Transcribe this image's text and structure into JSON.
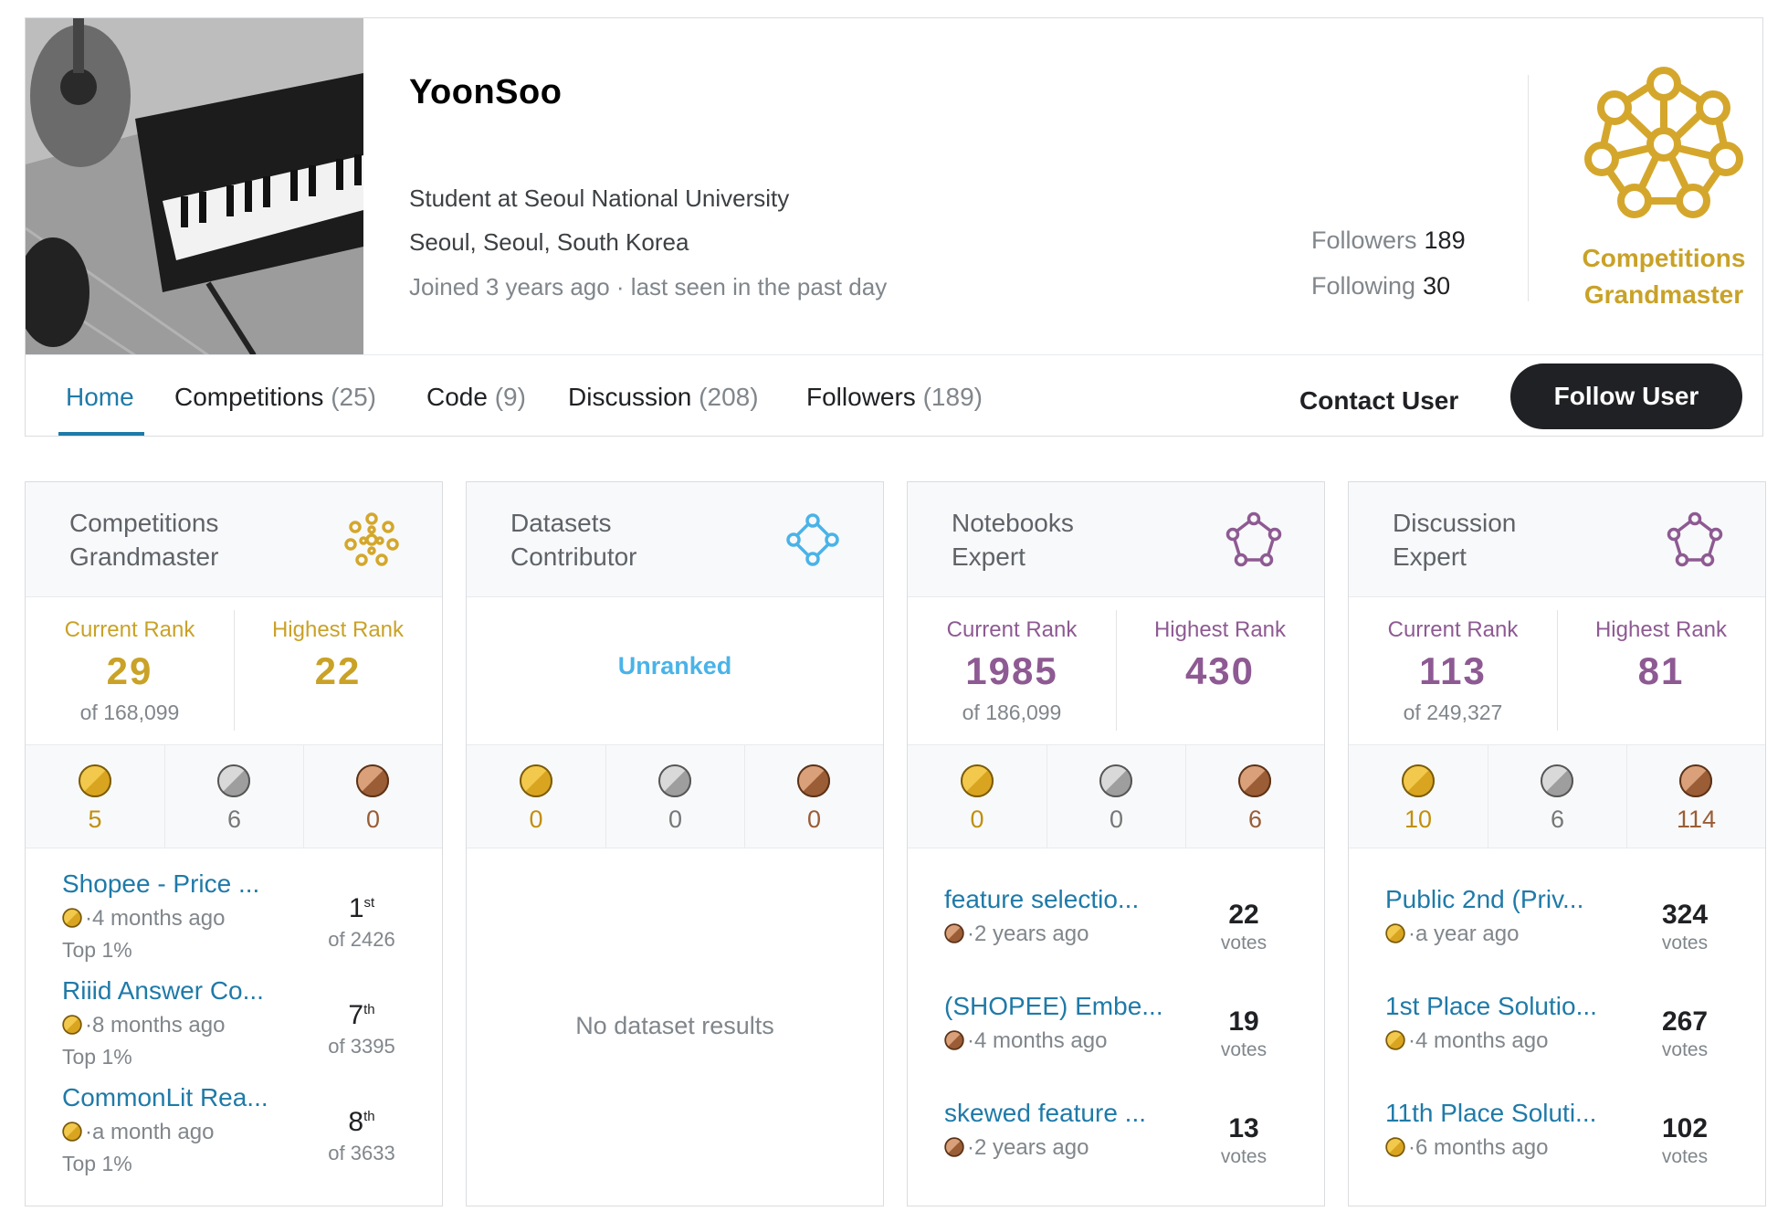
{
  "profile": {
    "name": "YoonSoo",
    "occupation": "Student at Seoul National University",
    "location": "Seoul, Seoul, South Korea",
    "meta": "Joined 3 years ago · last seen in the past day",
    "followers_label": "Followers",
    "followers_count": "189",
    "following_label": "Following",
    "following_count": "30",
    "tier_line1": "Competitions",
    "tier_line2": "Grandmaster",
    "tier_color": "#c9a227"
  },
  "tabs": [
    {
      "label": "Home",
      "count": ""
    },
    {
      "label": "Competitions",
      "count": "(25)"
    },
    {
      "label": "Code",
      "count": "(9)"
    },
    {
      "label": "Discussion",
      "count": "(208)"
    },
    {
      "label": "Followers",
      "count": "(189)"
    }
  ],
  "actions": {
    "contact": "Contact User",
    "follow": "Follow User"
  },
  "colors": {
    "gold": "#c9a227",
    "blue": "#4ab3e8",
    "purple": "#8e5a93",
    "link": "#1f7aa8"
  },
  "cards": [
    {
      "title_line1": "Competitions",
      "title_line2": "Grandmaster",
      "icon": "grandmaster-icon",
      "current_label": "Current Rank",
      "current": "29",
      "of": "of 168,099",
      "highest_label": "Highest Rank",
      "highest": "22",
      "medals": {
        "gold": "5",
        "silver": "6",
        "bronze": "0"
      },
      "items": [
        {
          "title": "Shopee - Price ...",
          "time": "4 months ago",
          "top": "Top 1%",
          "place": "1",
          "suffix": "st",
          "of": "of 2426"
        },
        {
          "title": "Riiid Answer Co...",
          "time": "8 months ago",
          "top": "Top 1%",
          "place": "7",
          "suffix": "th",
          "of": "of 3395"
        },
        {
          "title": "CommonLit Rea...",
          "time": "a month ago",
          "top": "Top 1%",
          "place": "8",
          "suffix": "th",
          "of": "of 3633"
        }
      ]
    },
    {
      "title_line1": "Datasets",
      "title_line2": "Contributor",
      "icon": "contributor-icon",
      "unranked": "Unranked",
      "medals": {
        "gold": "0",
        "silver": "0",
        "bronze": "0"
      },
      "empty": "No dataset results"
    },
    {
      "title_line1": "Notebooks",
      "title_line2": "Expert",
      "icon": "expert-icon",
      "current_label": "Current Rank",
      "current": "1985",
      "of": "of 186,099",
      "highest_label": "Highest Rank",
      "highest": "430",
      "medals": {
        "gold": "0",
        "silver": "0",
        "bronze": "6"
      },
      "items": [
        {
          "title": "feature selectio...",
          "time": "2 years ago",
          "votes": "22",
          "votes_label": "votes",
          "medal": "bronze"
        },
        {
          "title": "(SHOPEE) Embe...",
          "time": "4 months ago",
          "votes": "19",
          "votes_label": "votes",
          "medal": "bronze"
        },
        {
          "title": "skewed feature ...",
          "time": "2 years ago",
          "votes": "13",
          "votes_label": "votes",
          "medal": "bronze"
        }
      ]
    },
    {
      "title_line1": "Discussion",
      "title_line2": "Expert",
      "icon": "expert-icon",
      "current_label": "Current Rank",
      "current": "113",
      "of": "of 249,327",
      "highest_label": "Highest Rank",
      "highest": "81",
      "medals": {
        "gold": "10",
        "silver": "6",
        "bronze": "114"
      },
      "items": [
        {
          "title": "Public 2nd (Priv...",
          "time": "a year ago",
          "votes": "324",
          "votes_label": "votes",
          "medal": "gold"
        },
        {
          "title": "1st Place Solutio...",
          "time": "4 months ago",
          "votes": "267",
          "votes_label": "votes",
          "medal": "gold"
        },
        {
          "title": "11th Place Soluti...",
          "time": "6 months ago",
          "votes": "102",
          "votes_label": "votes",
          "medal": "gold"
        }
      ]
    }
  ]
}
